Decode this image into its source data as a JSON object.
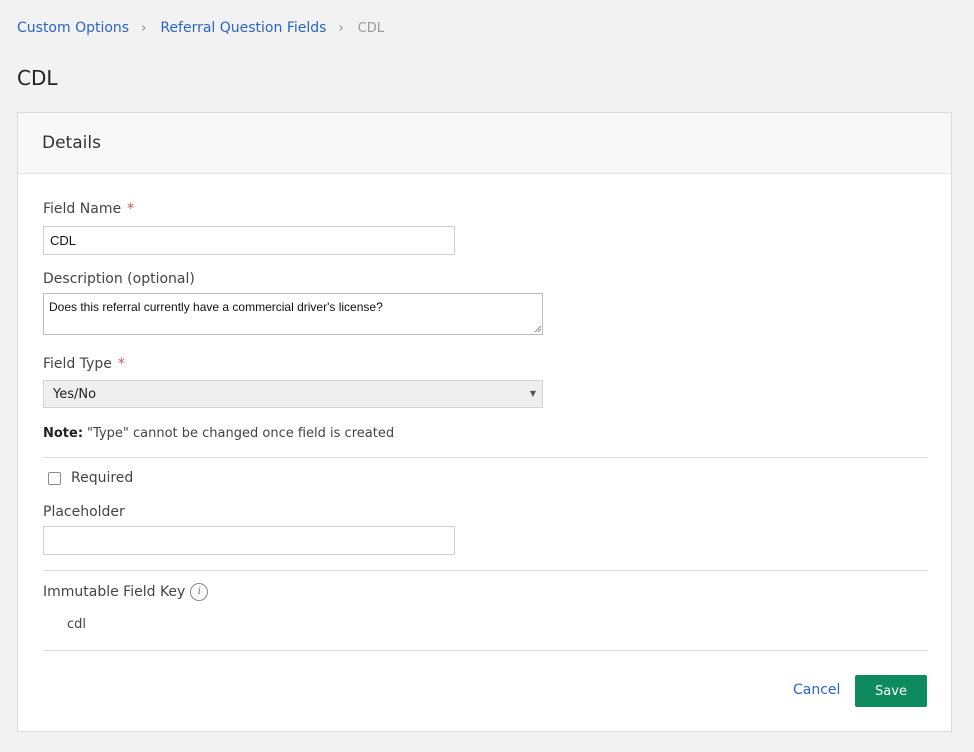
{
  "breadcrumb": {
    "items": [
      {
        "label": "Custom Options"
      },
      {
        "label": "Referral Question Fields"
      }
    ],
    "current": "CDL",
    "separator": "›"
  },
  "page": {
    "title": "CDL"
  },
  "card": {
    "title": "Details"
  },
  "form": {
    "field_name": {
      "label": "Field Name",
      "required_mark": "*",
      "value": "CDL"
    },
    "description": {
      "label": "Description (optional)",
      "value": "Does this referral currently have a commercial driver's license?"
    },
    "field_type": {
      "label": "Field Type",
      "required_mark": "*",
      "selected": "Yes/No",
      "arrow": "▼"
    },
    "note": {
      "prefix": "Note:",
      "text": "\"Type\" cannot be changed once field is created"
    },
    "required": {
      "label": "Required",
      "checked": false
    },
    "placeholder": {
      "label": "Placeholder",
      "value": ""
    },
    "immutable_key": {
      "label": "Immutable Field Key",
      "info_glyph": "i",
      "value": "cdl"
    }
  },
  "actions": {
    "cancel": "Cancel",
    "save": "Save"
  },
  "colors": {
    "link": "#2a64c5",
    "primary": "#0e8a5f",
    "required": "#d9534f",
    "background": "#f2f2f2"
  }
}
